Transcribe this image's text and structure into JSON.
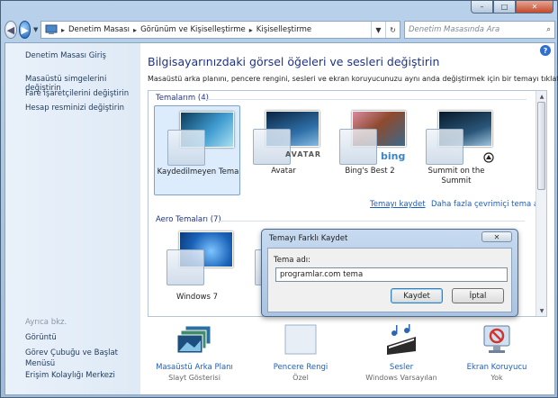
{
  "window": {
    "controls": {
      "minimize": "–",
      "maximize": "□",
      "close": "✕"
    }
  },
  "navbar": {
    "back_glyph": "◀",
    "forward_glyph": "▶",
    "dropdown_glyph": "▼",
    "breadcrumb": [
      "Denetim Masası",
      "Görünüm ve Kişiselleştirme",
      "Kişiselleştirme"
    ],
    "separator": "▸",
    "refresh_glyph": "↻",
    "search_placeholder": "Denetim Masasında Ara",
    "search_glyph": "⌕"
  },
  "sidebar": {
    "home": "Denetim Masası Giriş",
    "links": [
      "Masaüstü simgelerini değiştirin",
      "Fare işaretçilerini değiştirin",
      "Hesap resminizi değiştirin"
    ],
    "see_also_title": "Ayrıca bkz.",
    "see_also": [
      "Görüntü",
      "Görev Çubuğu ve Başlat Menüsü",
      "Erişim Kolaylığı Merkezi"
    ]
  },
  "main": {
    "help_glyph": "?",
    "heading": "Bilgisayarınızdaki görsel öğeleri ve sesleri değiştirin",
    "subtext": "Masaüstü arka planını, pencere rengini, sesleri ve ekran koruyucunuzu aynı anda değiştirmek için bir temayı tıklatın.",
    "my_themes_label": "Temalarım (4)",
    "my_themes": [
      {
        "name": "Kaydedilmeyen Tema",
        "selected": true,
        "bg": "#2a6e9a",
        "glass": "#dfe9f4"
      },
      {
        "name": "Avatar",
        "selected": false,
        "bg": "#1f4f7a",
        "glass": "#cfdcea",
        "badge": "AVATAR"
      },
      {
        "name": "Bing's Best 2",
        "selected": false,
        "bg": "#b25b3a",
        "glass": "#e5ecf4",
        "badge": "bing"
      },
      {
        "name": "Summit on the Summit",
        "selected": false,
        "bg": "#1a3b55",
        "glass": "#d9e5f1"
      }
    ],
    "save_theme_link": "Temayı kaydet",
    "more_themes_link": "Daha fazla çevrimiçi tema al",
    "aero_label": "Aero Temaları (7)",
    "aero_themes": [
      {
        "name": "Windows 7",
        "bg": "#1c6fc4",
        "glass": "#d7e4f1"
      }
    ],
    "scroll_up": "▲",
    "scroll_down": "▼"
  },
  "bottom": [
    {
      "label": "Masaüstü Arka Planı",
      "sub": "Slayt Gösterisi",
      "icon": "desktop-background-icon"
    },
    {
      "label": "Pencere Rengi",
      "sub": "Özel",
      "icon": "window-color-icon"
    },
    {
      "label": "Sesler",
      "sub": "Windows Varsayılan",
      "icon": "sounds-icon"
    },
    {
      "label": "Ekran Koruyucu",
      "sub": "Yok",
      "icon": "screensaver-icon"
    }
  ],
  "dialog": {
    "title": "Temayı Farklı Kaydet",
    "close_glyph": "✕",
    "field_label": "Tema adı:",
    "field_value": "programlar.com tema",
    "save_button": "Kaydet",
    "cancel_button": "İptal"
  }
}
